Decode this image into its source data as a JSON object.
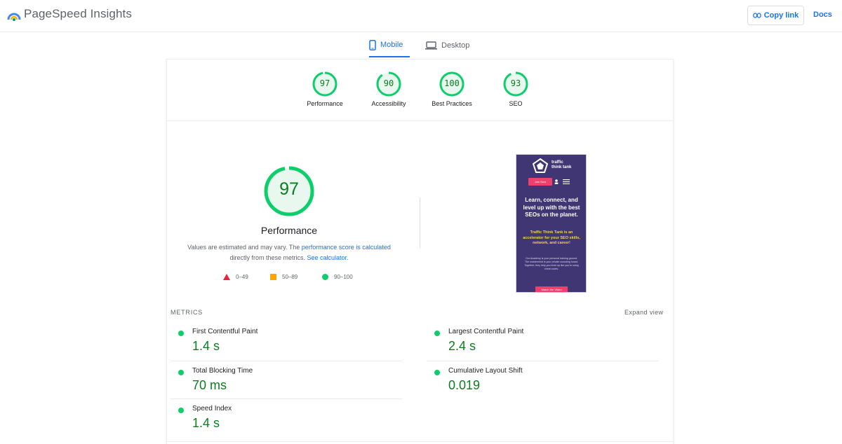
{
  "app": {
    "title": "PageSpeed Insights",
    "copy_link": "Copy link",
    "docs": "Docs"
  },
  "tabs": [
    {
      "label": "Mobile",
      "active": true
    },
    {
      "label": "Desktop",
      "active": false
    }
  ],
  "categories": [
    {
      "score": "97",
      "label": "Performance"
    },
    {
      "score": "90",
      "label": "Accessibility"
    },
    {
      "score": "100",
      "label": "Best Practices"
    },
    {
      "score": "93",
      "label": "SEO"
    }
  ],
  "performance": {
    "score": "97",
    "title": "Performance",
    "desc_part1": "Values are estimated and may vary. The ",
    "desc_link1": "performance score is calculated",
    "desc_part2": " directly from these metrics. ",
    "desc_link2": "See calculator."
  },
  "legend": [
    {
      "range": "0–49",
      "shape": "triangle",
      "color": "#e2263e"
    },
    {
      "range": "50–89",
      "shape": "square",
      "color": "#ffa400"
    },
    {
      "range": "90–100",
      "shape": "circle",
      "color": "#0cce6b"
    }
  ],
  "screenshot": {
    "brand_line1": "traffic",
    "brand_line2": "think tank",
    "btn_label": "Join Now",
    "headline": "Learn, connect, and level up with the best SEOs on the planet.",
    "subhead": "Traffic Think Tank is an accelerator for your SEO skills, network, and career!",
    "body": "Our Academy is your personal training ground. The mastermind is your private sounding board. Together, they help you level up like you're using cheat codes.",
    "cta": "Watch the Video"
  },
  "metrics_section": {
    "title": "METRICS",
    "expand": "Expand view",
    "items": [
      {
        "label": "First Contentful Paint",
        "value": "1.4 s"
      },
      {
        "label": "Largest Contentful Paint",
        "value": "2.4 s"
      },
      {
        "label": "Total Blocking Time",
        "value": "70 ms"
      },
      {
        "label": "Cumulative Layout Shift",
        "value": "0.019"
      },
      {
        "label": "Speed Index",
        "value": "1.4 s"
      }
    ]
  },
  "colors": {
    "accent": "#1a73e8",
    "pass": "#0cce6b",
    "pass_text": "#0a7e1f",
    "average": "#ffa400",
    "fail": "#e2263e",
    "screenshot_bg": "#3f3673"
  }
}
